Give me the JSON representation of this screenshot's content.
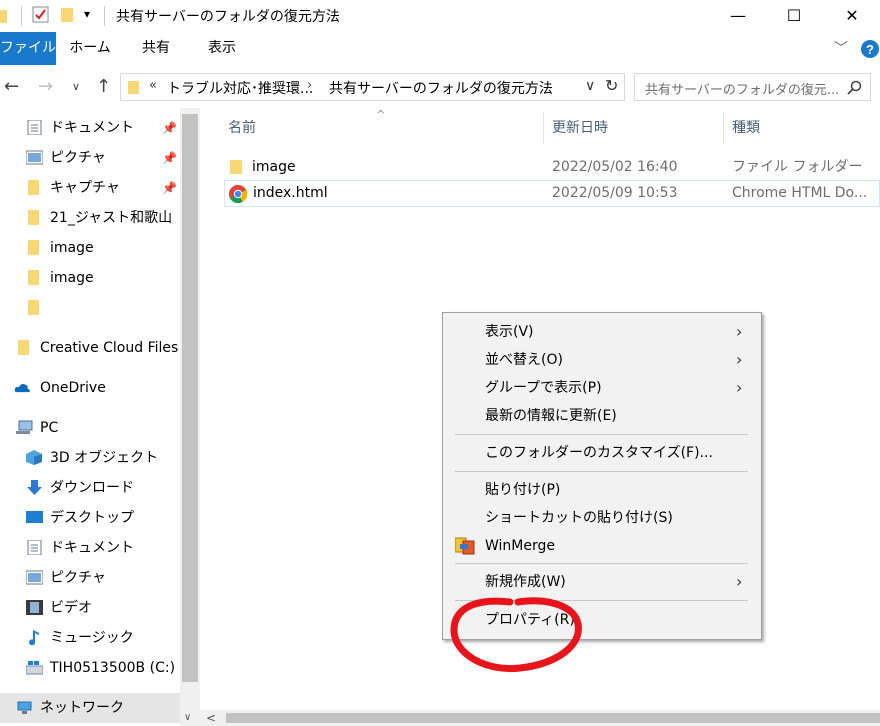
{
  "window": {
    "title": "共有サーバーのフォルダの復元方法",
    "minimize": "—",
    "maximize": "☐",
    "close": "✕"
  },
  "ribbon": {
    "tabs": [
      "ファイル",
      "ホーム",
      "共有",
      "表示"
    ]
  },
  "address": {
    "path_prefix": "«",
    "crumbs": [
      "トラブル対応･推奨環...",
      "共有サーバーのフォルダの復元方法"
    ],
    "search_placeholder": "共有サーバーのフォルダの復元..."
  },
  "nav": {
    "items": [
      {
        "label": "ドキュメント",
        "icon": "document-icon",
        "pinned": true
      },
      {
        "label": "ピクチャ",
        "icon": "picture-icon",
        "pinned": true
      },
      {
        "label": "キャプチャ",
        "icon": "folder-icon",
        "pinned": true
      },
      {
        "label": "21_ジャスト和歌山",
        "icon": "folder-icon",
        "pinned": false
      },
      {
        "label": "image",
        "icon": "folder-icon",
        "pinned": false
      },
      {
        "label": "image",
        "icon": "folder-icon",
        "pinned": false
      },
      {
        "label": "",
        "icon": "folder-icon",
        "pinned": false
      },
      {
        "label": "Creative Cloud Files P",
        "icon": "folder-icon",
        "pinned": false
      },
      {
        "label": "OneDrive",
        "icon": "cloud-icon",
        "pinned": false
      },
      {
        "label": "PC",
        "icon": "pc-icon",
        "pinned": false
      },
      {
        "label": "3D オブジェクト",
        "icon": "cube-icon",
        "pinned": false
      },
      {
        "label": "ダウンロード",
        "icon": "download-icon",
        "pinned": false
      },
      {
        "label": "デスクトップ",
        "icon": "desktop-icon",
        "pinned": false
      },
      {
        "label": "ドキュメント",
        "icon": "document-icon",
        "pinned": false
      },
      {
        "label": "ピクチャ",
        "icon": "picture-icon",
        "pinned": false
      },
      {
        "label": "ビデオ",
        "icon": "video-icon",
        "pinned": false
      },
      {
        "label": "ミュージック",
        "icon": "music-icon",
        "pinned": false
      },
      {
        "label": "TIH0513500B (C:)",
        "icon": "drive-icon",
        "pinned": false
      },
      {
        "label": "ネットワーク",
        "icon": "network-icon",
        "pinned": false
      }
    ]
  },
  "files": {
    "columns": [
      "名前",
      "更新日時",
      "種類"
    ],
    "rows": [
      {
        "name": "image",
        "date": "2022/05/02 16:40",
        "type": "ファイル フォルダー",
        "icon": "folder-icon"
      },
      {
        "name": "index.html",
        "date": "2022/05/09 10:53",
        "type": "Chrome HTML Do...",
        "icon": "chrome-icon"
      }
    ]
  },
  "context_menu": {
    "view": "表示(V)",
    "sort": "並べ替え(O)",
    "group": "グループで表示(P)",
    "refresh": "最新の情報に更新(E)",
    "customize": "このフォルダーのカスタマイズ(F)...",
    "paste": "貼り付け(P)",
    "paste_shortcut": "ショートカットの貼り付け(S)",
    "winmerge": "WinMerge",
    "new": "新規作成(W)",
    "properties": "プロパティ(R)"
  },
  "colors": {
    "accent": "#1979ca",
    "annotation": "#e8141b",
    "folder": "#f8d775"
  }
}
